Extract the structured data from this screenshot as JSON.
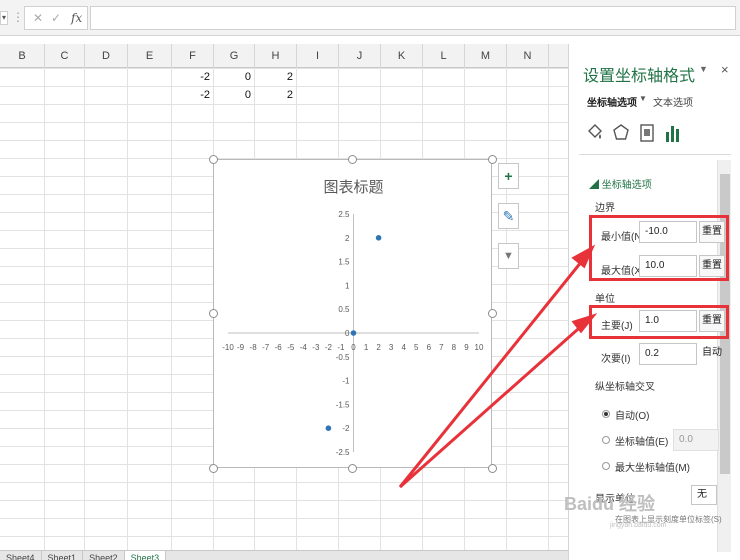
{
  "columns": [
    "B",
    "C",
    "D",
    "E",
    "F",
    "G",
    "H",
    "I",
    "J",
    "K",
    "L",
    "M",
    "N"
  ],
  "cells": [
    {
      "row": 0,
      "col": "F",
      "value": "-2"
    },
    {
      "row": 0,
      "col": "G",
      "value": "0"
    },
    {
      "row": 0,
      "col": "H",
      "value": "2"
    },
    {
      "row": 1,
      "col": "F",
      "value": "-2"
    },
    {
      "row": 1,
      "col": "G",
      "value": "0"
    },
    {
      "row": 1,
      "col": "H",
      "value": "2"
    }
  ],
  "formula_bar": {
    "fx_label": "fx",
    "cancel": "✕",
    "enter": "✓"
  },
  "chart": {
    "title": "图表标题",
    "tools": {
      "add": "+",
      "style": "✎",
      "filter": "▼"
    }
  },
  "chart_data": {
    "type": "scatter",
    "title": "图表标题",
    "series": [
      {
        "points": [
          [
            -2,
            -2
          ],
          [
            0,
            0
          ],
          [
            2,
            2
          ]
        ]
      }
    ],
    "xlim": [
      -10,
      10
    ],
    "ylim": [
      -2.5,
      2.5
    ],
    "xticks": [
      -10,
      -9,
      -8,
      -7,
      -6,
      -5,
      -4,
      -3,
      -2,
      -1,
      0,
      1,
      2,
      3,
      4,
      5,
      6,
      7,
      8,
      9,
      10
    ],
    "yticks": [
      "2.5",
      "2",
      "1.5",
      "1",
      "0.5",
      "0",
      "-0.5",
      "-1",
      "-1.5",
      "-2",
      "-2.5"
    ],
    "point_color": "#2e75b6"
  },
  "sheet_tabs": [
    "Sheet4",
    "Sheet1",
    "Sheet2",
    "Sheet3"
  ],
  "pane": {
    "title": "设置坐标轴格式",
    "close": "×",
    "dropdown": "▼",
    "tab_axis_options": "坐标轴选项",
    "tab_text_options": "文本选项",
    "section_title": "坐标轴选项",
    "bounds_label": "边界",
    "min_label": "最小值(N)",
    "min_value": "-10.0",
    "max_label": "最大值(X)",
    "max_value": "10.0",
    "reset": "重置",
    "units_label": "单位",
    "major_label": "主要(J)",
    "major_value": "1.0",
    "minor_label": "次要(I)",
    "minor_value": "0.2",
    "auto": "自动",
    "cross_label": "纵坐标轴交叉",
    "radio_auto": "自动(O)",
    "radio_value": "坐标轴值(E)",
    "radio_value_field": "0.0",
    "radio_max": "最大坐标轴值(M)",
    "display_units_label": "显示单位",
    "display_units_value": "无",
    "show_units_label": "在图表上显示刻度单位标签(S)"
  },
  "colors": {
    "accent": "#217346",
    "highlight": "#e8323a"
  },
  "watermark": {
    "text": "Baidu 经验",
    "sub": "jingyan.baidu.com"
  }
}
